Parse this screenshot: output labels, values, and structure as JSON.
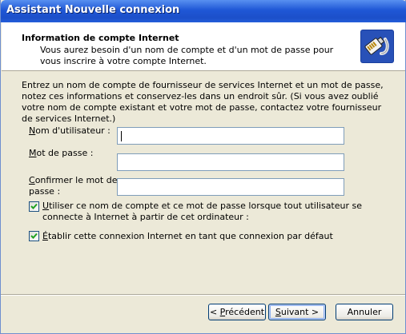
{
  "window": {
    "title": "Assistant Nouvelle connexion"
  },
  "header": {
    "title": "Information de compte Internet",
    "subtitle": "Vous aurez besoin d'un nom de compte et d'un mot de passe pour vous inscrire à votre compte Internet."
  },
  "intro": "Entrez un nom de compte de fournisseur de services Internet et un mot de passe, notez ces informations et conservez-les dans un endroit sûr. (Si vous avez oublié votre nom de compte existant et votre mot de passe, contactez votre fournisseur de services Internet.)",
  "fields": {
    "username": {
      "label_accel": "N",
      "label_rest": "om d'utilisateur :",
      "value": ""
    },
    "password": {
      "label_accel": "M",
      "label_rest": "ot de passe :",
      "value": ""
    },
    "confirm": {
      "label_accel": "C",
      "label_rest_line1": "onfirmer le mot de",
      "label_line2": "passe :",
      "value": ""
    }
  },
  "checkboxes": {
    "use_for_all": {
      "accel": "U",
      "rest": "tiliser ce nom de compte et ce mot de passe lorsque tout utilisateur se connecte à Internet à partir de cet ordinateur :",
      "checked": true
    },
    "default_connection": {
      "accel": "É",
      "rest": "tablir cette connexion Internet en tant que connexion par défaut",
      "checked": true
    }
  },
  "buttons": {
    "back": {
      "prefix": "< ",
      "accel": "P",
      "rest": "récédent"
    },
    "next": {
      "accel": "S",
      "rest": "uivant >"
    },
    "cancel": {
      "label": "Annuler"
    }
  }
}
